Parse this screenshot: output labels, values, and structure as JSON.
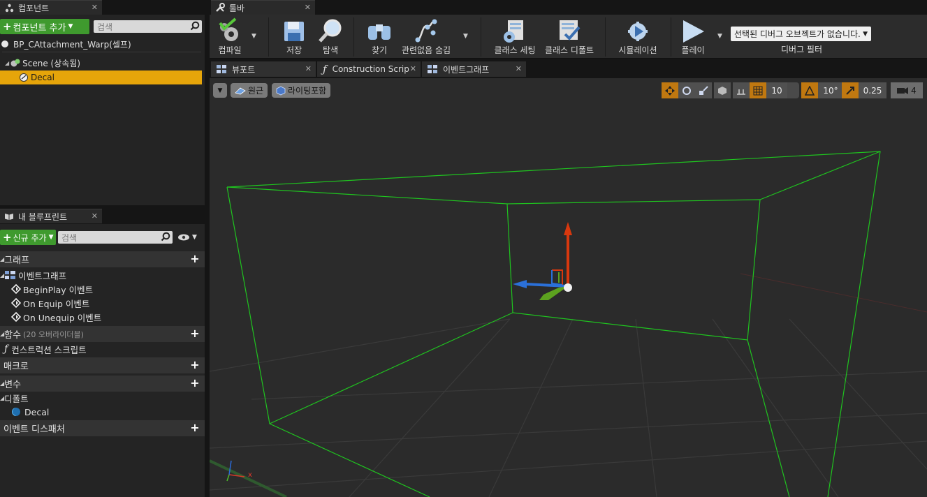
{
  "components_panel": {
    "tab_title": "컴포넌트",
    "add_button": "컴포넌트 추가",
    "search_placeholder": "검색",
    "tree": {
      "root": "BP_CAttachment_Warp(셀프)",
      "scene": "Scene (상속됨)",
      "decal": "Decal"
    }
  },
  "toolbar_panel": {
    "tab_title": "툴바",
    "buttons": {
      "compile": "컴파일",
      "save": "저장",
      "browse": "탐색",
      "find": "찾기",
      "hide_unrelated": "관련없음 숨김",
      "class_settings": "클래스 세팅",
      "class_defaults": "클래스 디폴트",
      "simulation": "시뮬레이션",
      "play": "플레이"
    },
    "debug_select": "선택된 디버그 오브젝트가 없습니다.",
    "debug_filter": "디버그 필터"
  },
  "doc_tabs": [
    "뷰포트",
    "Construction Scrip",
    "이벤트그래프"
  ],
  "viewport": {
    "perspective": "원근",
    "lighting": "라이팅포함",
    "grid_snap": "10",
    "rotation_snap": "10°",
    "scale_snap": "0.25",
    "camera_speed": "4",
    "axis_x": "x"
  },
  "my_blueprint": {
    "tab_title": "내 블루프린트",
    "add_button": "신규 추가",
    "search_placeholder": "검색",
    "sections": {
      "graph": "그래프",
      "functions": "함수",
      "functions_override": "(20 오버라이더블)",
      "macros": "매크로",
      "variables": "변수",
      "dispatchers": "이벤트 디스패처"
    },
    "graph_items": {
      "event_graph": "이벤트그래프",
      "events": [
        "BeginPlay 이벤트",
        "On Equip 이벤트",
        "On Unequip 이벤트"
      ]
    },
    "function_items": [
      "컨스트럭션 스크립트"
    ],
    "variable_category": "디폴트",
    "variable_items": [
      "Decal"
    ]
  },
  "colors": {
    "accent": "#e6a50a",
    "add_green": "#3f9a2e",
    "wireframe": "#1fc41f"
  }
}
